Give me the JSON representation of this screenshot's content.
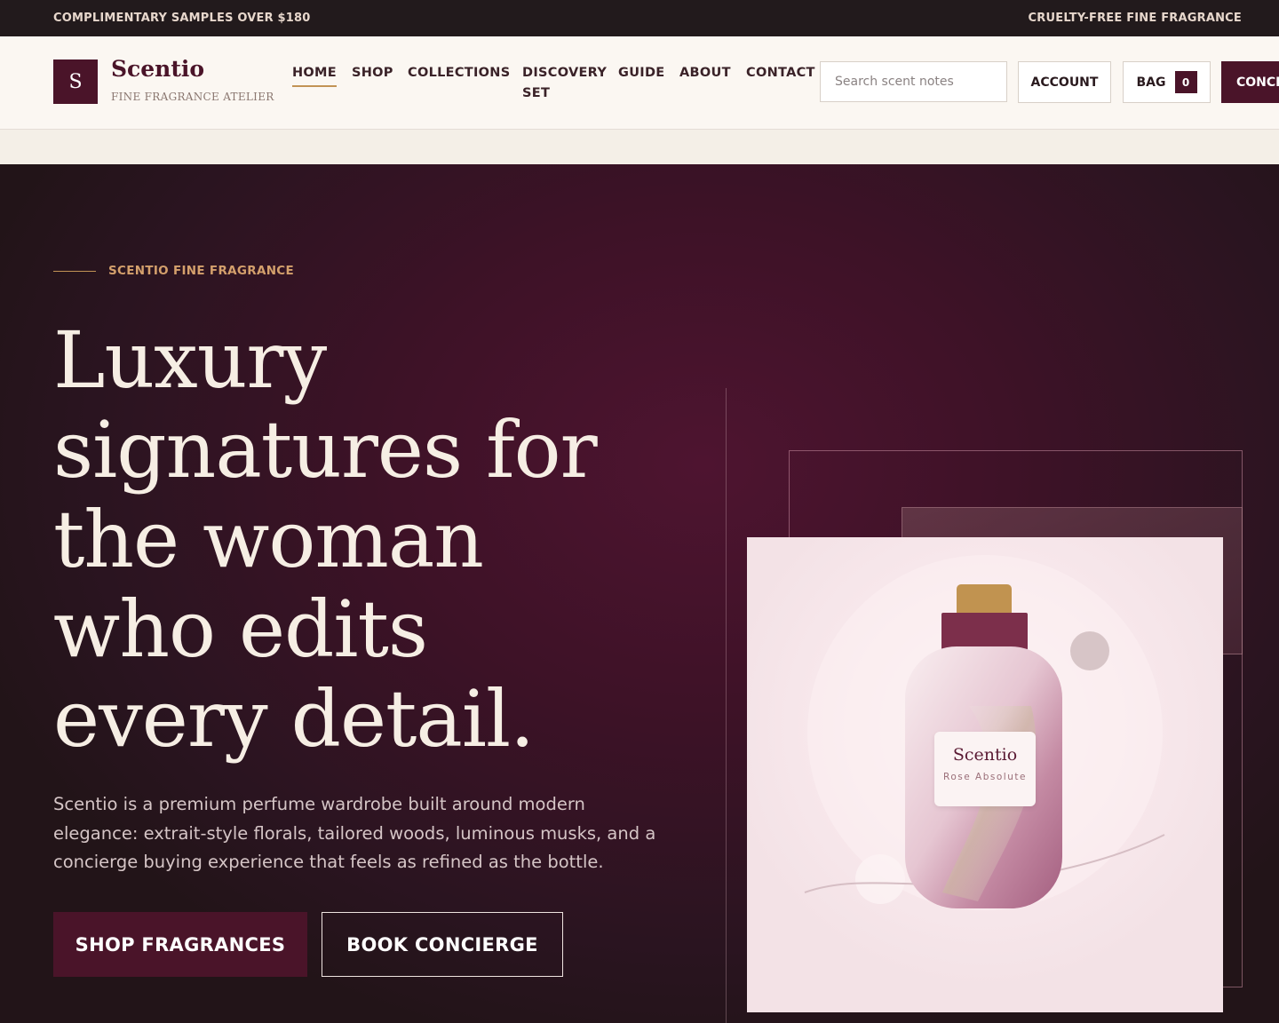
{
  "announcement": {
    "left": "COMPLIMENTARY SAMPLES OVER $180",
    "right": "CRUELTY-FREE FINE FRAGRANCE"
  },
  "brand": {
    "monogram": "S",
    "name": "Scentio",
    "tagline": "FINE FRAGRANCE ATELIER"
  },
  "nav": {
    "items": [
      "HOME",
      "SHOP",
      "COLLECTIONS",
      "DISCOVERY SET",
      "GUIDE",
      "ABOUT",
      "CONTACT"
    ],
    "active": "HOME"
  },
  "search": {
    "placeholder": "Search scent notes"
  },
  "actions": {
    "account": "ACCOUNT",
    "bag": "BAG",
    "bag_count": "0",
    "concierge": "CONCIERGE"
  },
  "hero": {
    "eyebrow": "SCENTIO FINE FRAGRANCE",
    "headline_lines": [
      "Luxury",
      "signatures for",
      "the woman",
      "who edits",
      "every detail."
    ],
    "lede": "Scentio is a premium perfume wardrobe built around modern elegance: extrait-style florals, tailored woods, luminous musks, and a concierge buying experience that feels as refined as the bottle.",
    "primary_cta": "SHOP FRAGRANCES",
    "secondary_cta": "BOOK CONCIERGE"
  },
  "product": {
    "label_brand": "Scentio",
    "label_name": "Rose Absolute"
  },
  "colors": {
    "accent": "#4a1429",
    "gold": "#c29355",
    "topbar": "#221a1c",
    "header_bg": "#fbf7f2"
  }
}
